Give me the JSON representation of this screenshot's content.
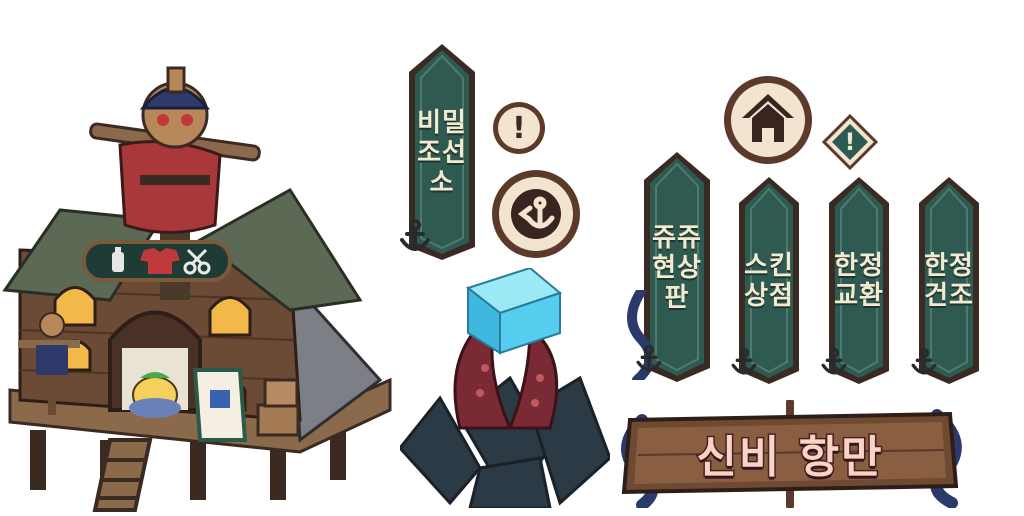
{
  "colors": {
    "banner_fill": "#2f5a52",
    "banner_border": "#3a2a24",
    "button_fill": "#f2e4cf",
    "button_ring": "#5b3a2a",
    "sign_wood": "#6e4a33",
    "sign_text": "#f6d4c6",
    "tentacle": "#2a3a6a"
  },
  "banners": {
    "secret_shipyard": {
      "line1": "비밀",
      "line2": "조선소",
      "icon": "anchor-icon"
    },
    "rare_board": {
      "line1": "쥬쥬",
      "line2": "현상판",
      "icon": "anchor-icon"
    },
    "skin_shop": {
      "line1": "스킨",
      "line2": "상점",
      "icon": "anchor-icon"
    },
    "limited_exchange": {
      "line1": "한정",
      "line2": "교환",
      "icon": "anchor-icon"
    },
    "limited_build": {
      "line1": "한정",
      "line2": "건조",
      "icon": "anchor-icon"
    }
  },
  "buttons": {
    "alert_round": {
      "glyph": "!",
      "icon": "exclamation-icon"
    },
    "anchor_round": {
      "icon": "anchor-arrow-icon"
    },
    "home_round": {
      "icon": "home-icon"
    },
    "alert_diamond": {
      "glyph": "!",
      "icon": "exclamation-icon"
    }
  },
  "sign": {
    "title": "신비 항만"
  },
  "shop_sign": {
    "icons": [
      "bottle-icon",
      "shirt-icon",
      "scissors-icon"
    ]
  }
}
